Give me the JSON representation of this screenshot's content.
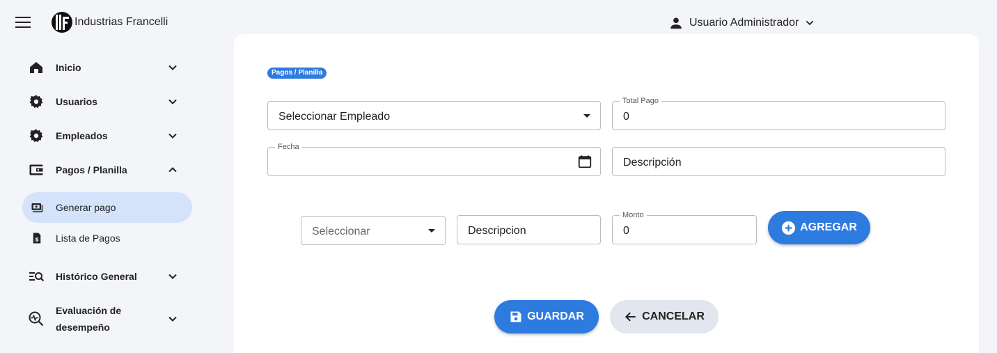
{
  "header": {
    "brand": "Industrias Francelli",
    "user": "Usuario Administrador"
  },
  "sidebar": {
    "items": [
      {
        "label": "Inicio",
        "icon": "home-icon"
      },
      {
        "label": "Usuarios",
        "icon": "gear-icon"
      },
      {
        "label": "Empleados",
        "icon": "gear-icon"
      },
      {
        "label": "Pagos / Planilla",
        "icon": "wallet-icon"
      },
      {
        "label": "Histórico General",
        "icon": "search-list-icon"
      },
      {
        "label": "Evaluación de",
        "label2": "desempeño",
        "icon": "search-pulse-icon"
      }
    ],
    "subitems": [
      {
        "label": "Generar pago",
        "icon": "payment-icon",
        "active": true
      },
      {
        "label": "Lista de Pagos",
        "icon": "receipt-icon",
        "active": false
      }
    ]
  },
  "main": {
    "breadcrumb": "Pagos / Planilla",
    "employee_select": "Seleccionar Empleado",
    "total_label": "Total Pago",
    "total_value": "0",
    "date_label": "Fecha",
    "date_value": "",
    "description_placeholder": "Descripción",
    "item_select": "Seleccionar",
    "item_description_placeholder": "Descripcion",
    "amount_label": "Monto",
    "amount_value": "0",
    "add_button": "AGREGAR",
    "save_button": "GUARDAR",
    "cancel_button": "CANCELAR"
  },
  "colors": {
    "accent": "#2e7be0",
    "active_nav": "#d4e3fa",
    "secondary_button": "#e2e7ef"
  }
}
